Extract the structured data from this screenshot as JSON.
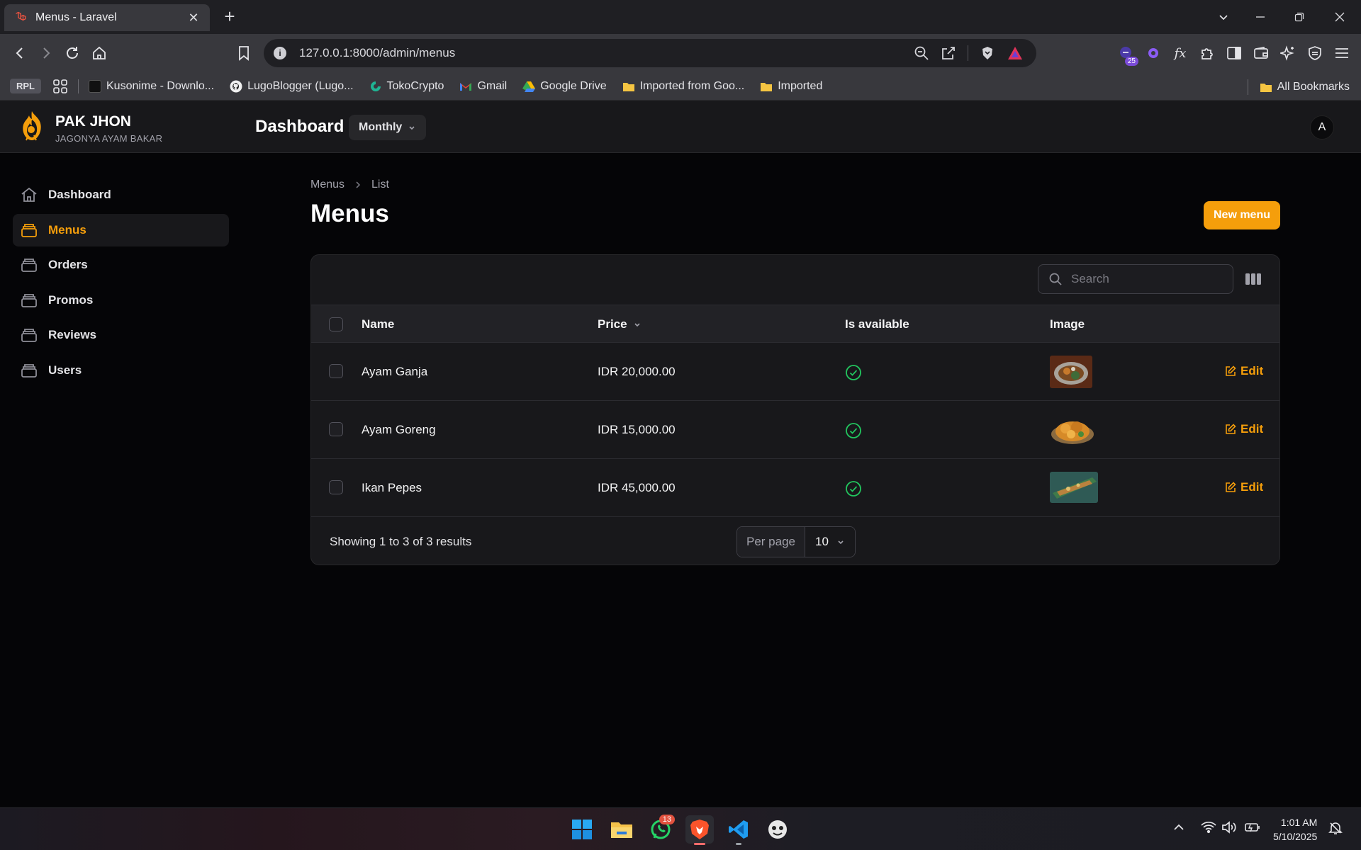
{
  "browser": {
    "tab_title": "Menus - Laravel",
    "url": "127.0.0.1:8000/admin/menus",
    "extension_badge": "25"
  },
  "bookmarks": {
    "folder_chip": "RPL",
    "items": [
      {
        "label": "Kusonime - Downlo..."
      },
      {
        "label": "LugoBlogger (Lugo..."
      },
      {
        "label": "TokoCrypto"
      },
      {
        "label": "Gmail"
      },
      {
        "label": "Google Drive"
      },
      {
        "label": "Imported from Goo..."
      },
      {
        "label": "Imported"
      }
    ],
    "all_bookmarks": "All Bookmarks"
  },
  "header": {
    "brand_name": "PAK JHON",
    "brand_tagline": "JAGONYA AYAM BAKAR",
    "title": "Dashboard",
    "filter": "Monthly",
    "avatar_initial": "A"
  },
  "sidebar": {
    "items": [
      {
        "label": "Dashboard",
        "active": false
      },
      {
        "label": "Menus",
        "active": true
      },
      {
        "label": "Orders",
        "active": false
      },
      {
        "label": "Promos",
        "active": false
      },
      {
        "label": "Reviews",
        "active": false
      },
      {
        "label": "Users",
        "active": false
      }
    ]
  },
  "page": {
    "breadcrumb": [
      "Menus",
      "List"
    ],
    "title": "Menus",
    "new_button": "New menu"
  },
  "table": {
    "search_placeholder": "Search",
    "columns": {
      "name": "Name",
      "price": "Price",
      "is_available": "Is available",
      "image": "Image"
    },
    "rows": [
      {
        "name": "Ayam Ganja",
        "price": "IDR 20,000.00",
        "available": true,
        "edit": "Edit"
      },
      {
        "name": "Ayam Goreng",
        "price": "IDR 15,000.00",
        "available": true,
        "edit": "Edit"
      },
      {
        "name": "Ikan Pepes",
        "price": "IDR 45,000.00",
        "available": true,
        "edit": "Edit"
      }
    ],
    "footer": {
      "showing": "Showing 1 to 3 of 3 results",
      "per_page_label": "Per page",
      "per_page_value": "10"
    }
  },
  "taskbar": {
    "whatsapp_badge": "13",
    "time": "1:01 AM",
    "date": "5/10/2025"
  },
  "colors": {
    "accent": "#f59e0b",
    "success": "#22c55e",
    "surface": "#18181b",
    "background": "#050507"
  }
}
